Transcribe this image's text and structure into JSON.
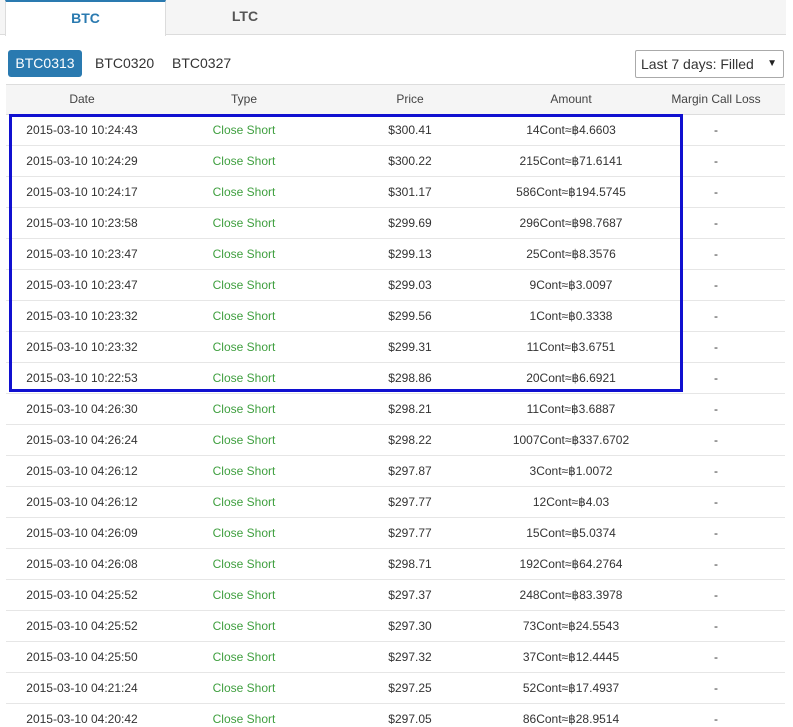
{
  "tabs": [
    {
      "label": "BTC",
      "active": true
    },
    {
      "label": "LTC",
      "active": false
    }
  ],
  "contracts": [
    {
      "label": "BTC0313",
      "active": true
    },
    {
      "label": "BTC0320",
      "active": false
    },
    {
      "label": "BTC0327",
      "active": false
    }
  ],
  "filter": {
    "selected": "Last 7 days: Filled"
  },
  "table": {
    "headers": [
      "Date",
      "Type",
      "Price",
      "Amount",
      "Margin Call Loss"
    ],
    "rows": [
      {
        "date": "2015-03-10 10:24:43",
        "type": "Close Short",
        "price": "$300.41",
        "amount": "14Cont≈฿4.6603",
        "margin": "-"
      },
      {
        "date": "2015-03-10 10:24:29",
        "type": "Close Short",
        "price": "$300.22",
        "amount": "215Cont≈฿71.6141",
        "margin": "-"
      },
      {
        "date": "2015-03-10 10:24:17",
        "type": "Close Short",
        "price": "$301.17",
        "amount": "586Cont≈฿194.5745",
        "margin": "-"
      },
      {
        "date": "2015-03-10 10:23:58",
        "type": "Close Short",
        "price": "$299.69",
        "amount": "296Cont≈฿98.7687",
        "margin": "-"
      },
      {
        "date": "2015-03-10 10:23:47",
        "type": "Close Short",
        "price": "$299.13",
        "amount": "25Cont≈฿8.3576",
        "margin": "-"
      },
      {
        "date": "2015-03-10 10:23:47",
        "type": "Close Short",
        "price": "$299.03",
        "amount": "9Cont≈฿3.0097",
        "margin": "-"
      },
      {
        "date": "2015-03-10 10:23:32",
        "type": "Close Short",
        "price": "$299.56",
        "amount": "1Cont≈฿0.3338",
        "margin": "-"
      },
      {
        "date": "2015-03-10 10:23:32",
        "type": "Close Short",
        "price": "$299.31",
        "amount": "11Cont≈฿3.6751",
        "margin": "-"
      },
      {
        "date": "2015-03-10 10:22:53",
        "type": "Close Short",
        "price": "$298.86",
        "amount": "20Cont≈฿6.6921",
        "margin": "-"
      },
      {
        "date": "2015-03-10 04:26:30",
        "type": "Close Short",
        "price": "$298.21",
        "amount": "11Cont≈฿3.6887",
        "margin": "-"
      },
      {
        "date": "2015-03-10 04:26:24",
        "type": "Close Short",
        "price": "$298.22",
        "amount": "1007Cont≈฿337.6702",
        "margin": "-"
      },
      {
        "date": "2015-03-10 04:26:12",
        "type": "Close Short",
        "price": "$297.87",
        "amount": "3Cont≈฿1.0072",
        "margin": "-"
      },
      {
        "date": "2015-03-10 04:26:12",
        "type": "Close Short",
        "price": "$297.77",
        "amount": "12Cont≈฿4.03",
        "margin": "-"
      },
      {
        "date": "2015-03-10 04:26:09",
        "type": "Close Short",
        "price": "$297.77",
        "amount": "15Cont≈฿5.0374",
        "margin": "-"
      },
      {
        "date": "2015-03-10 04:26:08",
        "type": "Close Short",
        "price": "$298.71",
        "amount": "192Cont≈฿64.2764",
        "margin": "-"
      },
      {
        "date": "2015-03-10 04:25:52",
        "type": "Close Short",
        "price": "$297.37",
        "amount": "248Cont≈฿83.3978",
        "margin": "-"
      },
      {
        "date": "2015-03-10 04:25:52",
        "type": "Close Short",
        "price": "$297.30",
        "amount": "73Cont≈฿24.5543",
        "margin": "-"
      },
      {
        "date": "2015-03-10 04:25:50",
        "type": "Close Short",
        "price": "$297.32",
        "amount": "37Cont≈฿12.4445",
        "margin": "-"
      },
      {
        "date": "2015-03-10 04:21:24",
        "type": "Close Short",
        "price": "$297.25",
        "amount": "52Cont≈฿17.4937",
        "margin": "-"
      },
      {
        "date": "2015-03-10 04:20:42",
        "type": "Close Short",
        "price": "$297.05",
        "amount": "86Cont≈฿28.9514",
        "margin": "-"
      }
    ]
  },
  "colors": {
    "accent": "#2a7ab0",
    "type_text": "#3f9f3f",
    "highlight_box": "#1010d0"
  }
}
